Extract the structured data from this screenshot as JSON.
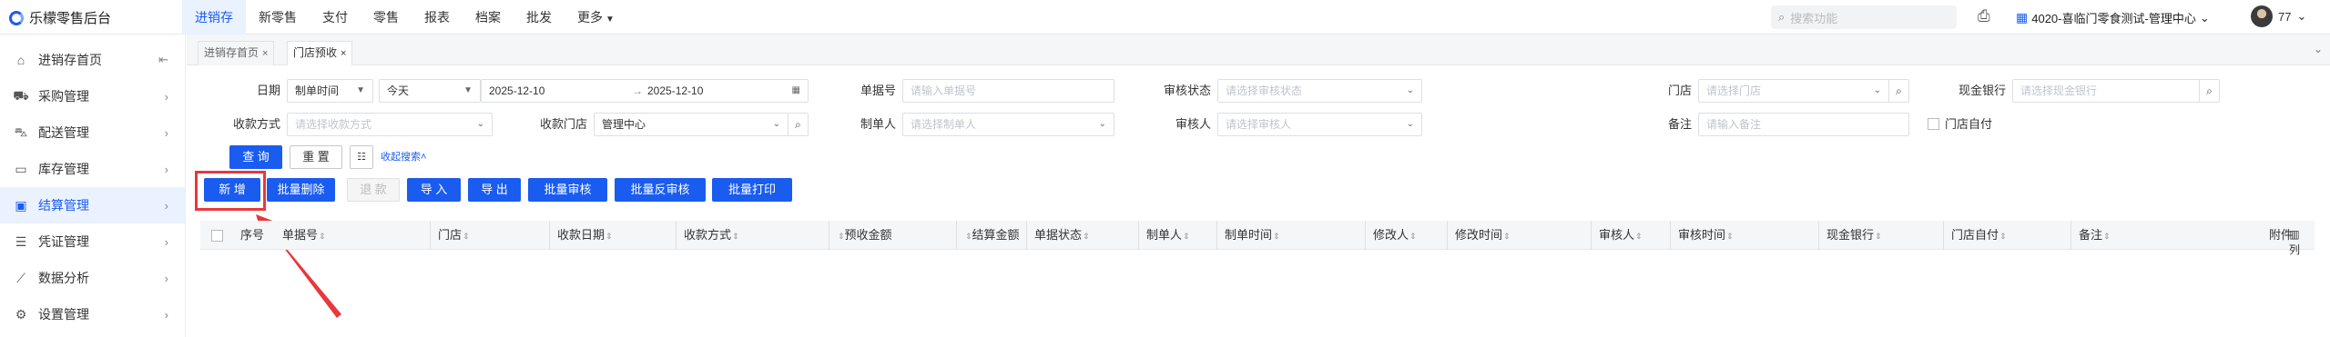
{
  "header": {
    "app_title": "乐檬零售后台",
    "nav": [
      "进销存",
      "新零售",
      "支付",
      "零售",
      "报表",
      "档案",
      "批发",
      "更多"
    ],
    "search_placeholder": "搜索功能",
    "store": "4020-喜临门零食测试-管理中心",
    "user": "77"
  },
  "sidebar": {
    "items": [
      {
        "label": "进销存首页",
        "icon": "home-icon"
      },
      {
        "label": "采购管理",
        "icon": "cart-icon"
      },
      {
        "label": "配送管理",
        "icon": "truck-icon"
      },
      {
        "label": "库存管理",
        "icon": "box-icon"
      },
      {
        "label": "结算管理",
        "icon": "calculator-icon"
      },
      {
        "label": "凭证管理",
        "icon": "document-icon"
      },
      {
        "label": "数据分析",
        "icon": "chart-icon"
      },
      {
        "label": "设置管理",
        "icon": "gear-icon"
      }
    ],
    "active_index": 4
  },
  "tabs": [
    {
      "label": "进销存首页"
    },
    {
      "label": "门店预收"
    }
  ],
  "filters": {
    "date_label": "日期",
    "date_type": "制单时间",
    "date_range_preset": "今天",
    "date_start": "2025-12-10",
    "date_end": "2025-12-10",
    "doc_no_label": "单据号",
    "doc_no_placeholder": "请输入单据号",
    "audit_status_label": "审核状态",
    "audit_status_placeholder": "请选择审核状态",
    "store_label": "门店",
    "store_placeholder": "请选择门店",
    "bank_label": "现金银行",
    "bank_placeholder": "请选择现金银行",
    "pay_method_label": "收款方式",
    "pay_method_placeholder": "请选择收款方式",
    "pay_store_label": "收款门店",
    "pay_store_value": "管理中心",
    "creator_label": "制单人",
    "creator_placeholder": "请选择制单人",
    "auditor_label": "审核人",
    "auditor_placeholder": "请选择审核人",
    "note_label": "备注",
    "note_placeholder": "请输入备注",
    "self_pay_label": "门店自付",
    "query": "查 询",
    "reset": "重 置",
    "collapse": "收起搜索"
  },
  "toolbar": {
    "add": "新 增",
    "batch_delete": "批量删除",
    "return": "退 款",
    "import": "导 入",
    "export": "导 出",
    "batch_audit": "批量审核",
    "batch_unaudit": "批量反审核",
    "batch_print": "批量打印"
  },
  "table": {
    "columns": [
      "序号",
      "单据号",
      "门店",
      "收款日期",
      "收款方式",
      "预收金额",
      "结算金额",
      "单据状态",
      "制单人",
      "制单时间",
      "修改人",
      "修改时间",
      "审核人",
      "审核时间",
      "现金银行",
      "门店自付",
      "备注",
      "附件"
    ],
    "column_settings": "列"
  },
  "colors": {
    "accent": "#1a5cf0",
    "highlight": "#e8383d"
  }
}
